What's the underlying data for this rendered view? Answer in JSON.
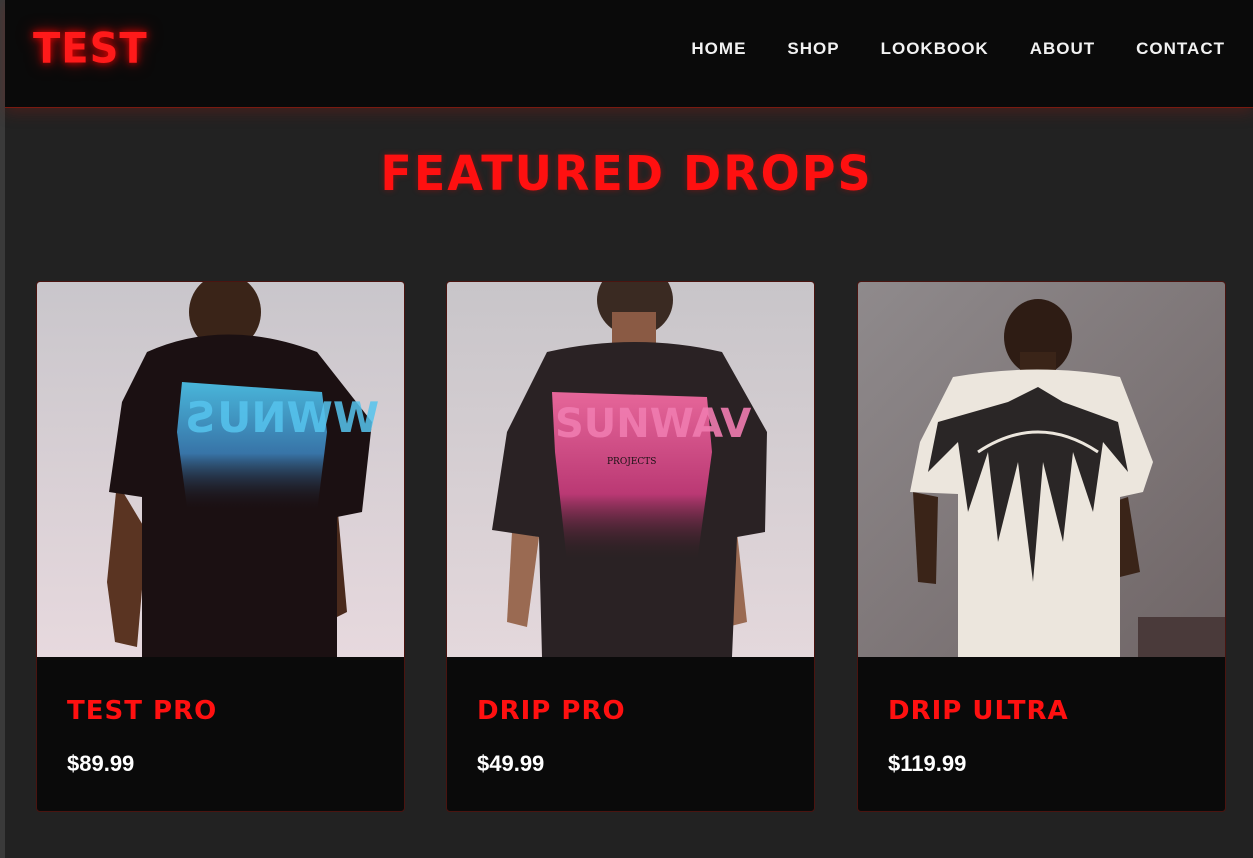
{
  "brand": {
    "logo_text": "TEST",
    "accent": "#ff1010"
  },
  "nav": {
    "items": [
      {
        "label": "HOME"
      },
      {
        "label": "SHOP"
      },
      {
        "label": "LOOKBOOK"
      },
      {
        "label": "ABOUT"
      },
      {
        "label": "CONTACT"
      }
    ]
  },
  "featured": {
    "title": "FEATURED DROPS",
    "products": [
      {
        "name": "TEST PRO",
        "price": "$89.99",
        "image": "black tee with blue graffiti back print"
      },
      {
        "name": "DRIP PRO",
        "price": "$49.99",
        "image": "black tee with pink graffiti back print"
      },
      {
        "name": "DRIP ULTRA",
        "price": "$119.99",
        "image": "cream tee with black winged back print"
      }
    ]
  }
}
